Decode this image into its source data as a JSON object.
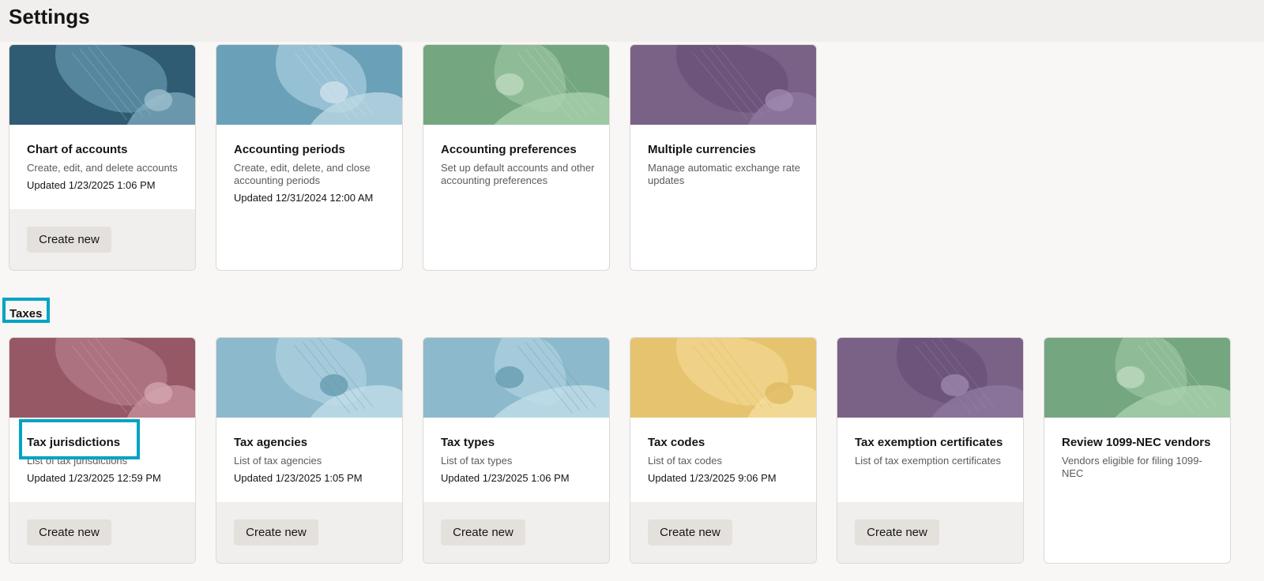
{
  "page": {
    "title": "Settings"
  },
  "sections": {
    "taxes_label": "Taxes"
  },
  "accounting_cards": [
    {
      "title": "Chart of accounts",
      "description": "Create, edit, and delete accounts",
      "updated": "Updated 1/23/2025 1:06 PM",
      "button": "Create new",
      "theme": "navy"
    },
    {
      "title": "Accounting periods",
      "description": "Create, edit, delete, and close accounting periods",
      "updated": "Updated 12/31/2024 12:00 AM",
      "button": null,
      "theme": "sky"
    },
    {
      "title": "Accounting preferences",
      "description": "Set up default accounts and other accounting preferences",
      "updated": null,
      "button": null,
      "theme": "green"
    },
    {
      "title": "Multiple currencies",
      "description": "Manage automatic exchange rate updates",
      "updated": null,
      "button": null,
      "theme": "purple"
    }
  ],
  "tax_cards": [
    {
      "title": "Tax jurisdictions",
      "description": "List of tax jurisdictions",
      "updated": "Updated 1/23/2025 12:59 PM",
      "button": "Create new",
      "theme": "rose"
    },
    {
      "title": "Tax agencies",
      "description": "List of tax agencies",
      "updated": "Updated 1/23/2025 1:05 PM",
      "button": "Create new",
      "theme": "lightblue"
    },
    {
      "title": "Tax types",
      "description": "List of tax types",
      "updated": "Updated 1/23/2025 1:06 PM",
      "button": "Create new",
      "theme": "lightblue"
    },
    {
      "title": "Tax codes",
      "description": "List of tax codes",
      "updated": "Updated 1/23/2025 9:06 PM",
      "button": "Create new",
      "theme": "yellow"
    },
    {
      "title": "Tax exemption certificates",
      "description": "List of tax exemption certificates",
      "updated": null,
      "button": "Create new",
      "theme": "purple"
    },
    {
      "title": "Review 1099-NEC vendors",
      "description": "Vendors eligible for filing 1099-NEC",
      "updated": null,
      "button": null,
      "theme": "green"
    }
  ],
  "colors": {
    "highlight": "#00a3c4",
    "navy": "#2f5b73",
    "sky": "#6aa1b9",
    "green": "#74a680",
    "purple": "#7a6287",
    "rose": "#955864",
    "lightblue": "#8cbacc",
    "yellow": "#e6c46f"
  }
}
